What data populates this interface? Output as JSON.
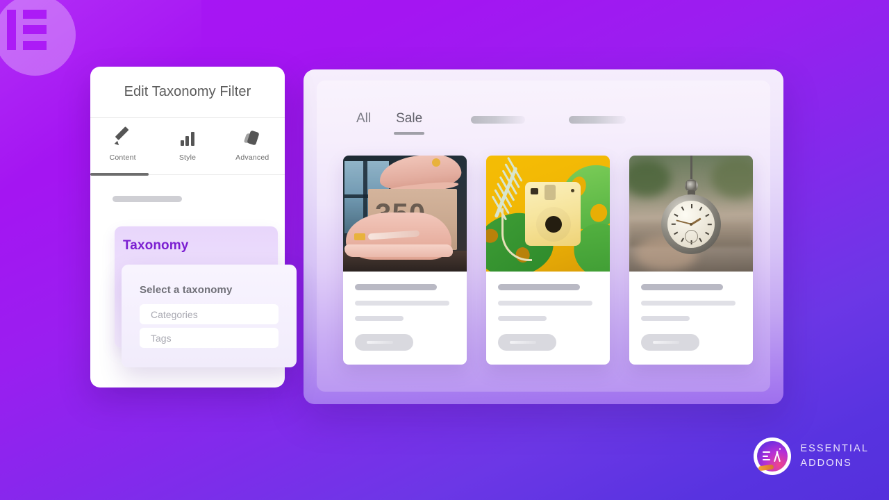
{
  "brand": {
    "elementor_logo": "elementor-logo-icon",
    "ea_name_line1": "ESSENTIAL",
    "ea_name_line2": "ADDONS",
    "ea_monogram": "EA"
  },
  "editor": {
    "title": "Edit Taxonomy Filter",
    "tabs": [
      {
        "label": "Content",
        "icon": "pencil-icon",
        "active": true
      },
      {
        "label": "Style",
        "icon": "bar-chart-icon",
        "active": false
      },
      {
        "label": "Advanced",
        "icon": "layers-icon",
        "active": false
      }
    ],
    "taxonomy_section": {
      "heading": "Taxonomy",
      "dropdown_title": "Select a taxonomy",
      "options": [
        "Categories",
        "Tags"
      ]
    }
  },
  "preview": {
    "filters": [
      {
        "label": "All",
        "active": false,
        "type": "text"
      },
      {
        "label": "Sale",
        "active": true,
        "type": "text"
      },
      {
        "label": "",
        "active": false,
        "type": "skeleton"
      },
      {
        "label": "",
        "active": false,
        "type": "skeleton"
      }
    ],
    "products": [
      {
        "image_alt": "pink-yeezy-350-sneaker-on-box",
        "box_text": "350"
      },
      {
        "image_alt": "yellow-instant-camera-with-tropical-leaves",
        "box_text": ""
      },
      {
        "image_alt": "vintage-pocket-watch-on-chain",
        "box_text": ""
      }
    ]
  },
  "colors": {
    "background_top": "#a915f5",
    "background_bottom": "#5430dc",
    "accent_purple": "#7b1fd1",
    "taxonomy_block": "#e8d6fb",
    "panel_white": "#ffffff"
  }
}
